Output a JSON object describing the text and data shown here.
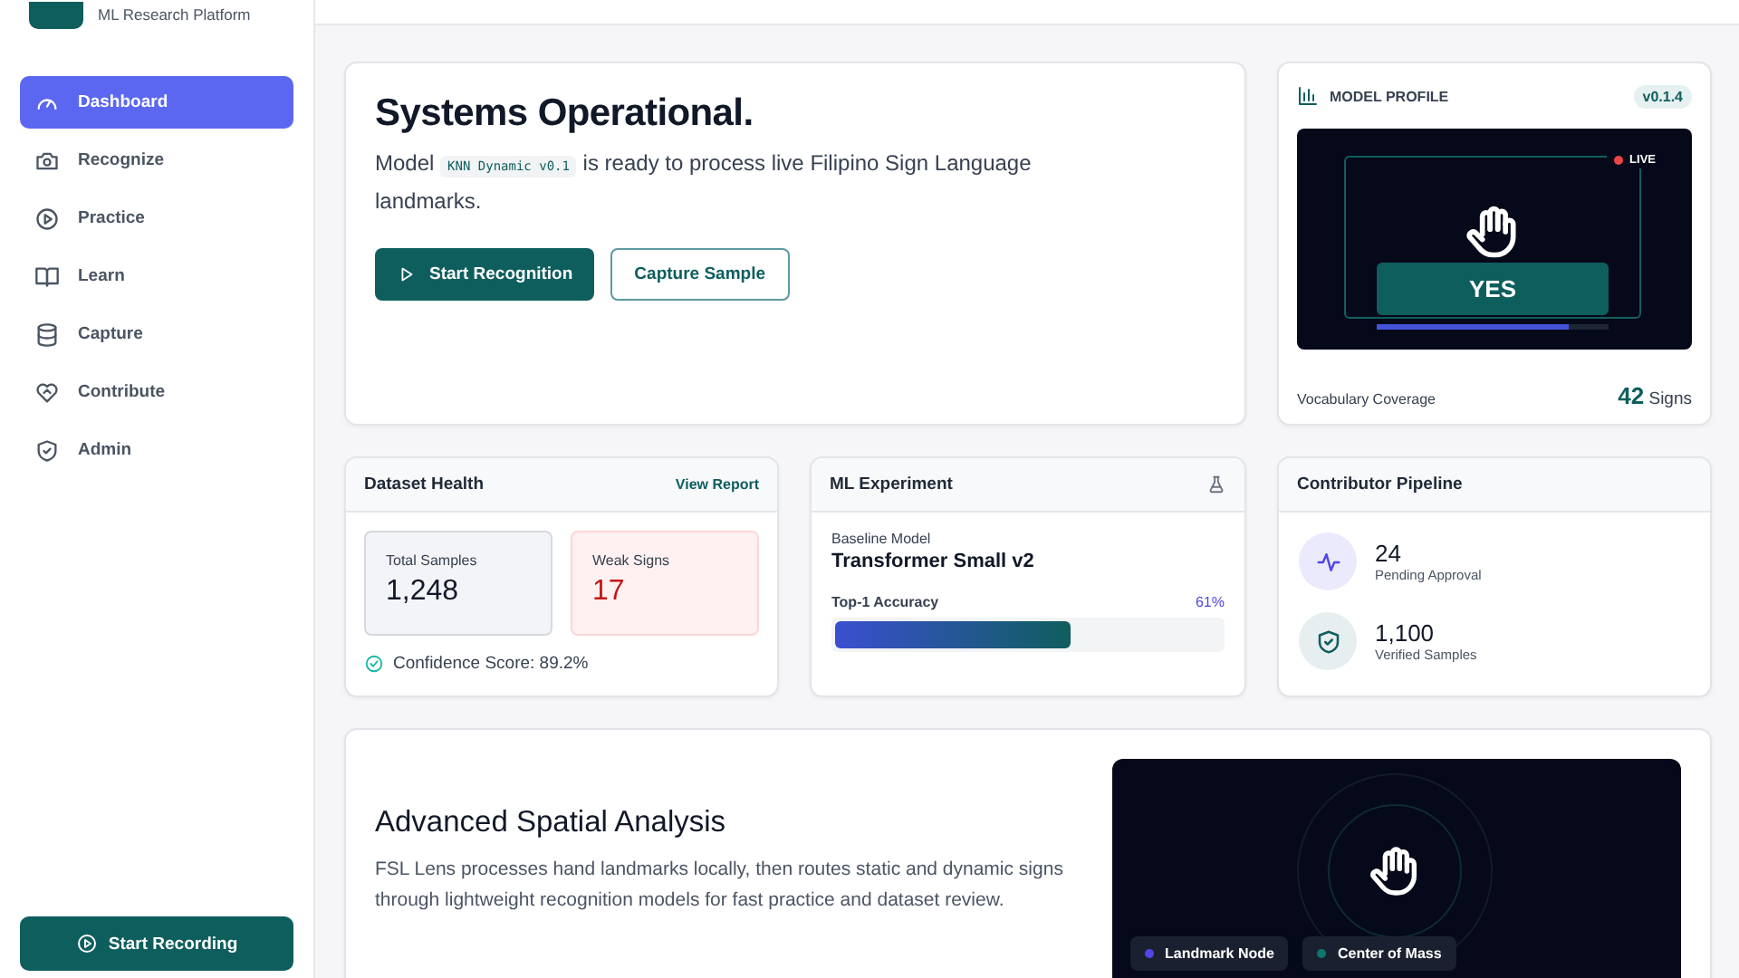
{
  "sidebar": {
    "subtitle": "ML Research Platform",
    "items": [
      {
        "label": "Dashboard",
        "selected": true
      },
      {
        "label": "Recognize",
        "selected": false
      },
      {
        "label": "Practice",
        "selected": false
      },
      {
        "label": "Learn",
        "selected": false
      },
      {
        "label": "Capture",
        "selected": false
      },
      {
        "label": "Contribute",
        "selected": false
      },
      {
        "label": "Admin",
        "selected": false
      }
    ],
    "record_button": "Start Recording"
  },
  "hero": {
    "title": "Systems Operational.",
    "text_before": "Model",
    "model_tag": "KNN Dynamic v0.1",
    "text_after": "is ready to process live Filipino Sign Language landmarks.",
    "buttons": [
      {
        "label": "Start Recognition",
        "kind": "primary"
      },
      {
        "label": "Capture Sample",
        "kind": "outline"
      }
    ]
  },
  "model_profile": {
    "title": "MODEL PROFILE",
    "version": "v0.1.4",
    "live": "LIVE",
    "prediction": "YES",
    "level": 0.83,
    "coverage_label": "Vocabulary Coverage",
    "coverage_value": "42",
    "coverage_unit": "Signs"
  },
  "dataset_health": {
    "title": "Dataset Health",
    "link": "View Report",
    "stats": [
      {
        "label": "Total Samples",
        "value": "1,248",
        "kind": "neutral"
      },
      {
        "label": "Weak Signs",
        "value": "17",
        "kind": "warning"
      }
    ],
    "confidence": "Confidence Score: 89.2%"
  },
  "ml_experiment": {
    "title": "ML Experiment",
    "baseline_label": "Baseline Model",
    "baseline": "Transformer Small v2",
    "metric": "Top-1 Accuracy",
    "reading": "61%",
    "level": 0.61
  },
  "pipeline": {
    "title": "Contributor Pipeline",
    "items": [
      {
        "value": "24",
        "label": "Pending Approval",
        "kind": "activity"
      },
      {
        "value": "1,100",
        "label": "Verified Samples",
        "kind": "verified"
      }
    ]
  },
  "analysis": {
    "title": "Advanced Spatial Analysis",
    "text": "FSL Lens processes hand landmarks locally, then routes static and dynamic signs through lightweight recognition models for fast practice and dataset review.",
    "legend": [
      {
        "label": "Landmark Node",
        "color": "#4f46e5"
      },
      {
        "label": "Center of Mass",
        "color": "#0f766e"
      }
    ]
  }
}
